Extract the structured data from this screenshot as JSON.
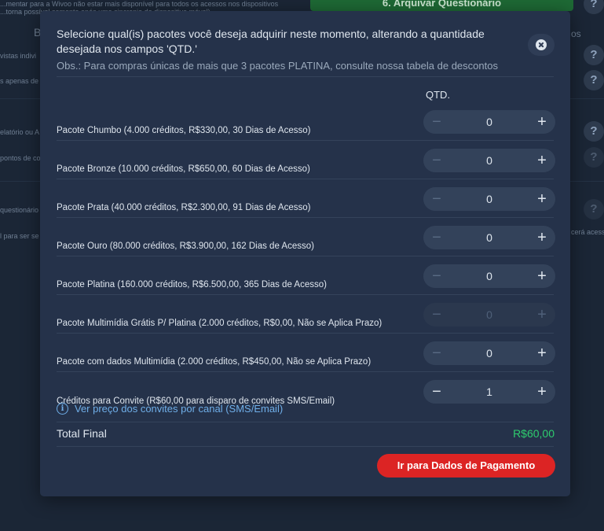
{
  "background": {
    "top_line_1": "...mentar para a Wivoo não estar mais disponível para todos os acessos nos dispositivos",
    "top_line_2": "...torna possível somente após uma sincronia do dispositivo móvel)",
    "green_button": "6. Arquivar Questionário",
    "left_texts": [
      "B",
      "vistas indivi",
      "s apenas de",
      "elatório ou A",
      "pontos de co",
      "questionário (",
      "l para ser se"
    ],
    "right_texts": [
      "os",
      "cerá acess"
    ],
    "help_mark": "?"
  },
  "modal": {
    "title": "Selecione qual(is) pacotes você deseja adquirir neste momento, alterando a quantidade desejada nos campos 'QTD.'",
    "obs": "Obs.: Para compras únicas de mais que 3 pacotes PLATINA, consulte nossa tabela de descontos",
    "qtd_header": "QTD.",
    "minus_symbol": "−",
    "plus_symbol": "+",
    "packages": [
      {
        "label": "Pacote Chumbo (4.000 créditos, R$330,00, 30 Dias de Acesso)",
        "qty": "0",
        "disabled": false
      },
      {
        "label": "Pacote Bronze (10.000 créditos, R$650,00, 60 Dias de Acesso)",
        "qty": "0",
        "disabled": false
      },
      {
        "label": "Pacote Prata (40.000 créditos, R$2.300,00, 91 Dias de Acesso)",
        "qty": "0",
        "disabled": false
      },
      {
        "label": "Pacote Ouro (80.000 créditos, R$3.900,00, 162 Dias de Acesso)",
        "qty": "0",
        "disabled": false
      },
      {
        "label": "Pacote Platina (160.000 créditos, R$6.500,00, 365 Dias de Acesso)",
        "qty": "0",
        "disabled": false
      },
      {
        "label": "Pacote Multimídia Grátis P/ Platina (2.000 créditos, R$0,00, Não se Aplica Prazo)",
        "qty": "0",
        "disabled": true
      },
      {
        "label": "Pacote com dados Multimídia (2.000 créditos, R$450,00, Não se Aplica Prazo)",
        "qty": "0",
        "disabled": false
      },
      {
        "label": "Créditos para Convite (R$60,00 para disparo de convites SMS/Email)",
        "qty": "1",
        "disabled": false
      }
    ],
    "convite_link": "Ver preço dos convites por canal (SMS/Email)",
    "info_glyph": "i",
    "total_label": "Total Final",
    "total_value": "R$60,00",
    "pay_button": "Ir para Dados de Pagamento"
  },
  "colors": {
    "modal_bg": "#25324a",
    "pay_button": "#dc2424",
    "total_value": "#2ecc6e",
    "link": "#6faee8"
  }
}
